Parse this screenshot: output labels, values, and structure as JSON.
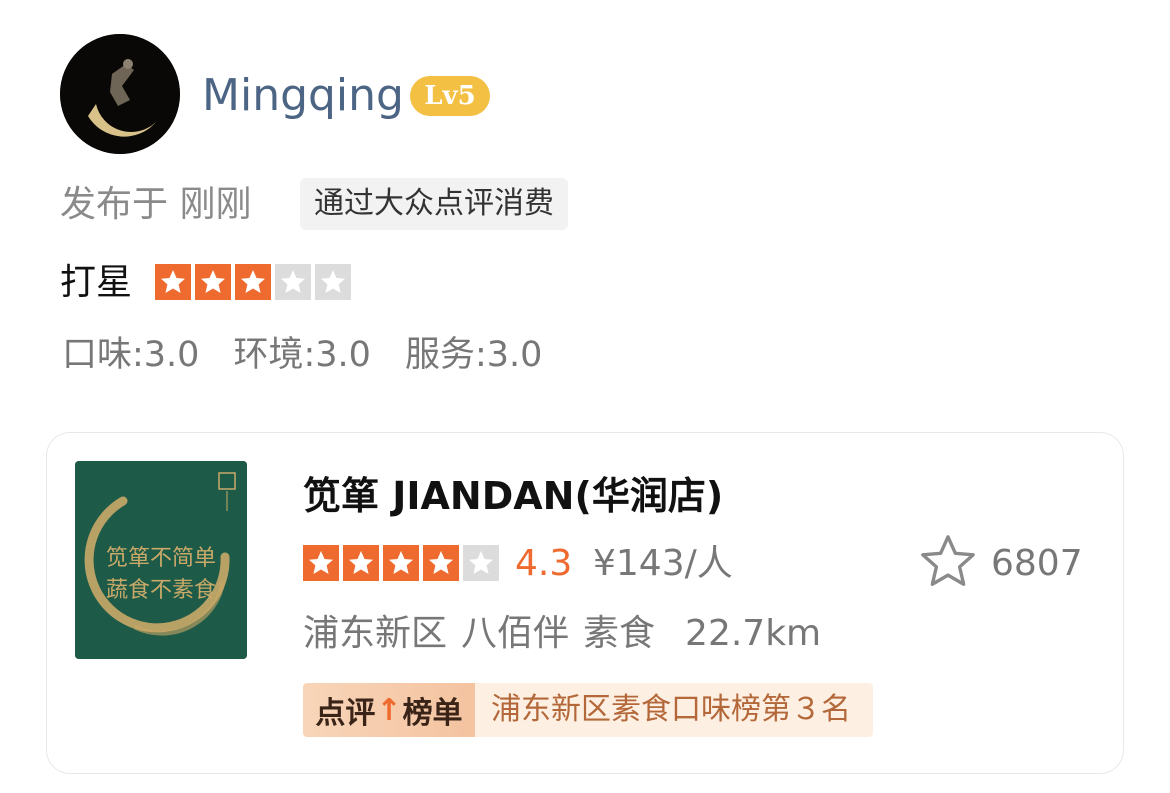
{
  "user": {
    "name": "Mingqing",
    "level": "Lv5",
    "avatar_icon": "crescent-moon-avatar"
  },
  "post": {
    "published": "发布于 刚刚",
    "source_tag": "通过大众点评消费"
  },
  "rating": {
    "label": "打星",
    "stars": 3,
    "max_stars": 5,
    "taste": "口味:3.0",
    "environment": "环境:3.0",
    "service": "服务:3.0"
  },
  "shop": {
    "name": "笕箪 JIANDAN(华润店)",
    "image_lines": [
      "笕箪不简单",
      "蔬食不素食"
    ],
    "stars": 4,
    "max_stars": 5,
    "score": "4.3",
    "price": "¥143/人",
    "favorite_icon": "star-outline-icon",
    "favorite_count": "6807",
    "district": "浦东新区",
    "area": "八佰伴",
    "category": "素食",
    "distance": "22.7km",
    "ranking_badge_pre": "点评",
    "ranking_badge_arrow": "↑",
    "ranking_badge_post": "榜单",
    "ranking_text": "浦东新区素食口味榜第３名"
  },
  "colors": {
    "star_active": "#ee6a2f",
    "star_inactive": "#dcdcdc",
    "username": "#4d6585",
    "level_badge": "#f3c043",
    "score": "#ee6a2f"
  }
}
